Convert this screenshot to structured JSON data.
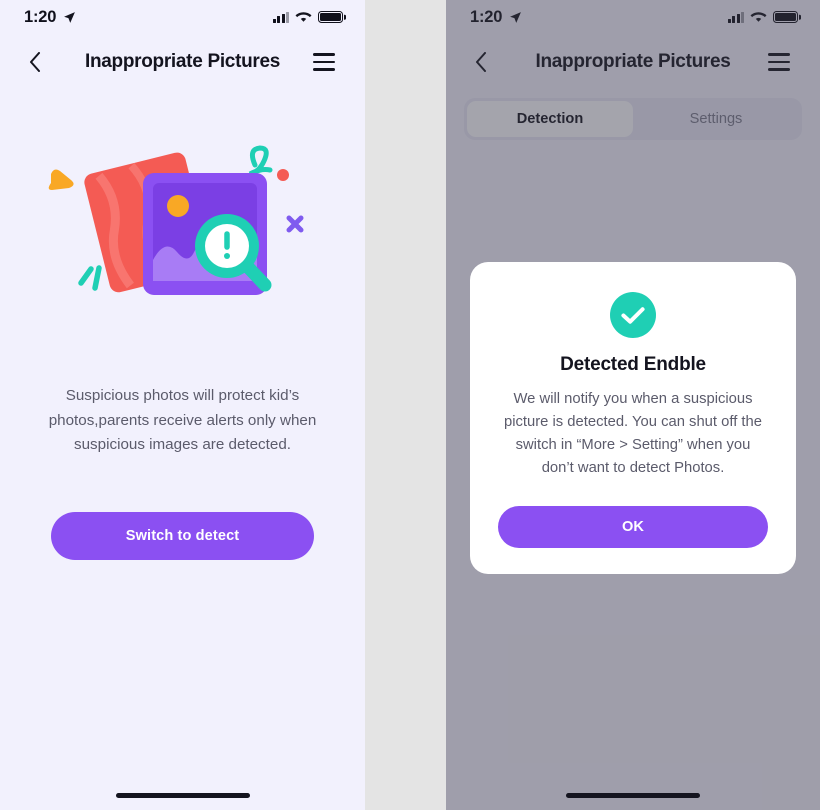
{
  "colors": {
    "background": "#f2f1fd",
    "gap": "#e4e4e4",
    "purple": "#8b50f2",
    "purple_light": "#a87cf5",
    "teal": "#1fcfb4",
    "orange": "#f9a825",
    "red": "#f45b54",
    "text_dark": "#14141f",
    "text_muted": "#5b5b6b"
  },
  "status_bar": {
    "time": "1:20",
    "location_icon": "location-arrow-icon",
    "signal_icon": "cellular-signal-icon",
    "wifi_icon": "wifi-icon",
    "battery_icon": "battery-full-icon"
  },
  "nav": {
    "back_icon": "chevron-left-icon",
    "title": "Inappropriate Pictures",
    "menu_icon": "hamburger-menu-icon"
  },
  "left_screen": {
    "illustration_name": "suspicious-photo-detection-illustration",
    "description": "Suspicious photos will protect kid’s photos,parents receive alerts only when suspicious images are detected.",
    "cta_label": "Switch to detect"
  },
  "right_screen": {
    "tabs": [
      {
        "label": "Detection",
        "active": true
      },
      {
        "label": "Settings",
        "active": false
      }
    ],
    "modal": {
      "icon": "check-circle-icon",
      "title": "Detected Endble",
      "body": "We will notify you when a suspicious picture is detected. You can shut off the switch in “More > Setting” when you don’t want to detect Photos.",
      "ok_label": "OK"
    }
  }
}
